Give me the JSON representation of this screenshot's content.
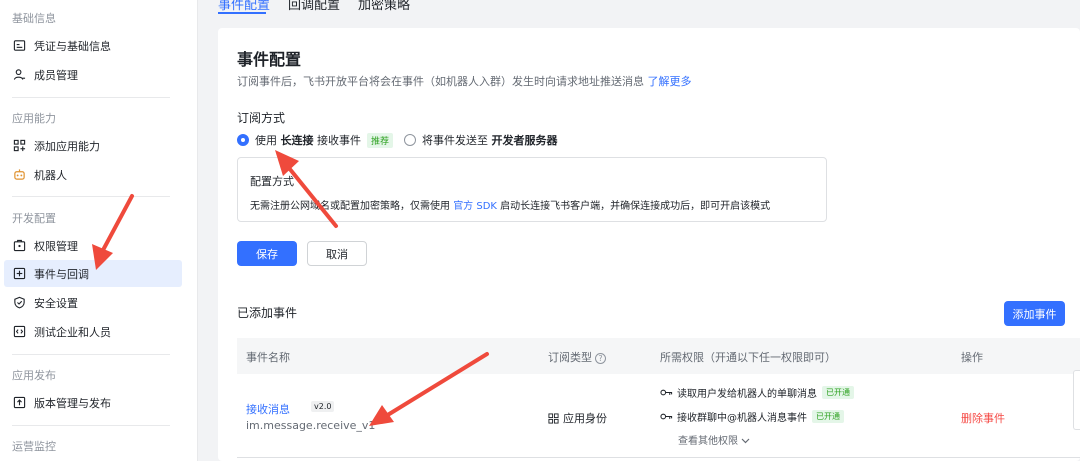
{
  "tabs": [
    "事件配置",
    "回调配置",
    "加密策略"
  ],
  "sidebar": {
    "sections": [
      {
        "title": "基础信息",
        "items": [
          {
            "label": "凭证与基础信息",
            "icon": "credential-icon"
          },
          {
            "label": "成员管理",
            "icon": "member-icon"
          }
        ]
      },
      {
        "title": "应用能力",
        "items": [
          {
            "label": "添加应用能力",
            "icon": "add-capability-icon"
          },
          {
            "label": "机器人",
            "icon": "robot-icon"
          }
        ]
      },
      {
        "title": "开发配置",
        "items": [
          {
            "label": "权限管理",
            "icon": "permission-icon"
          },
          {
            "label": "事件与回调",
            "icon": "event-callback-icon"
          },
          {
            "label": "安全设置",
            "icon": "shield-icon"
          },
          {
            "label": "测试企业和人员",
            "icon": "code-icon"
          }
        ]
      },
      {
        "title": "应用发布",
        "items": [
          {
            "label": "版本管理与发布",
            "icon": "upload-icon"
          }
        ]
      },
      {
        "title": "运营监控",
        "items": []
      }
    ],
    "active_item": "事件与回调"
  },
  "main": {
    "title": "事件配置",
    "desc_text": "订阅事件后，飞书开放平台将会在事件（如机器人入群）发生时向请求地址推送消息",
    "desc_link": "了解更多",
    "subscribe_title": "订阅方式",
    "option1": {
      "prefix": "使用",
      "bold": "长连接",
      "suffix": "接收事件",
      "tag": "推荐",
      "selected": true
    },
    "option2": {
      "prefix": "将事件发送至",
      "bold": "开发者服务器",
      "selected": false
    },
    "config_box": {
      "title": "配置方式",
      "text_before": "无需注册公网域名或配置加密策略，仅需使用",
      "link": "官方 SDK",
      "text_after": "启动长连接飞书客户端，并确保连接成功后，即可开启该模式"
    },
    "save_label": "保存",
    "cancel_label": "取消",
    "added_title": "已添加事件",
    "add_event_label": "添加事件",
    "table": {
      "headers": [
        "事件名称",
        "订阅类型",
        "所需权限（开通以下任一权限即可）",
        "操作"
      ],
      "rows": [
        {
          "name": "接收消息",
          "version": "v2.0",
          "code": "im.message.receive_v1",
          "sub_type": "应用身份",
          "permissions": [
            {
              "label": "读取用户发给机器人的单聊消息",
              "status": "已开通"
            },
            {
              "label": "接收群聊中@机器人消息事件",
              "status": "已开通"
            }
          ],
          "more": "查看其他权限",
          "action": "删除事件"
        }
      ]
    }
  },
  "colors": {
    "accent": "#3370ff",
    "danger": "#f54a45",
    "success": "#2ea121",
    "annotation": "#ef4a3c"
  }
}
